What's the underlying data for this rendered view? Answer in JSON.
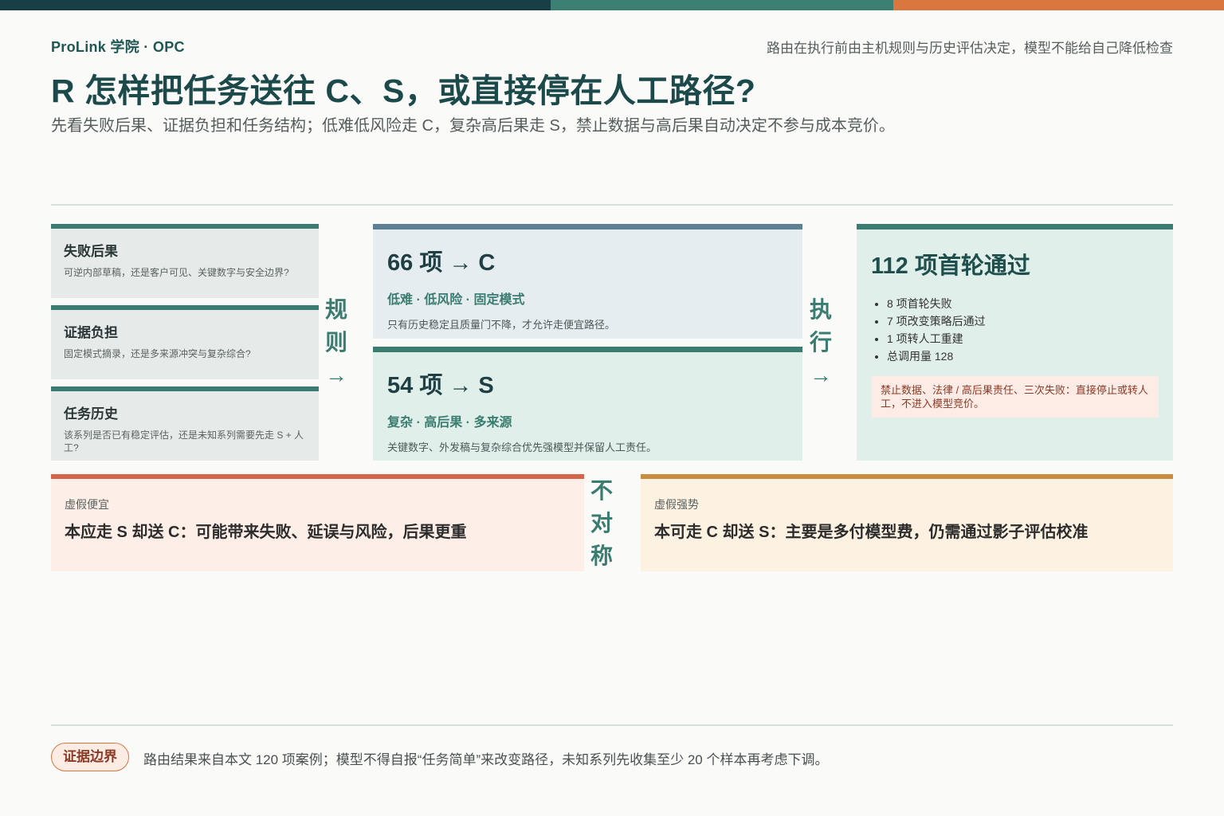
{
  "header": {
    "brand": "ProLink 学院 · OPC",
    "note": "路由在执行前由主机规则与历史评估决定，模型不能给自己降低检查",
    "title": "R 怎样把任务送往 C、S，或直接停在人工路径?",
    "subtitle": "先看失败后果、证据负担和任务结构；低难低风险走 C，复杂高后果走 S，禁止数据与高后果自动决定不参与成本竞价。"
  },
  "factors": [
    {
      "title": "失败后果",
      "desc": "可逆内部草稿，还是客户可见、关键数字与安全边界?"
    },
    {
      "title": "证据负担",
      "desc": "固定模式摘录，还是多来源冲突与复杂综合?"
    },
    {
      "title": "任务历史",
      "desc": "该系列是否已有稳定评估，还是未知系列需要先走 S + 人工?"
    }
  ],
  "connectors": {
    "rules": [
      "规",
      "则",
      "→"
    ],
    "execute": [
      "执",
      "行",
      "→"
    ],
    "asymmetric": [
      "不",
      "对",
      "称"
    ]
  },
  "routes": [
    {
      "headline": "66 项 → C",
      "tags": "低难 · 低风险 · 固定模式",
      "desc": "只有历史稳定且质量门不降，才允许走便宜路径。"
    },
    {
      "headline": "54 项 → S",
      "tags": "复杂 · 高后果 · 多来源",
      "desc": "关键数字、外发稿与复杂综合优先强模型并保留人工责任。"
    }
  ],
  "result": {
    "headline": "112 项首轮通过",
    "items": [
      "8 项首轮失败",
      "7 项改变策略后通过",
      "1 项转人工重建",
      "总调用量 128"
    ],
    "warning": "禁止数据、法律 / 高后果责任、三次失败：直接停止或转人工，不进入模型竞价。"
  },
  "tradeoffs": [
    {
      "kicker": "虚假便宜",
      "text": "本应走 S 却送 C：可能带来失败、延误与风险，后果更重"
    },
    {
      "kicker": "虚假强势",
      "text": "本可走 C 却送 S：主要是多付模型费，仍需通过影子评估校准"
    }
  ],
  "footer": {
    "badge": "证据边界",
    "text": "路由结果来自本文 120 项案例；模型不得自报“任务简单”来改变路径，未知系列先收集至少 20 个样本再考虑下调。"
  },
  "colors": {
    "bar_dark": "#173d45",
    "teal": "#3a7c70",
    "slate": "#5f7f93",
    "orange": "#d9773f",
    "red": "#d2654a",
    "amber": "#c98d3f"
  }
}
